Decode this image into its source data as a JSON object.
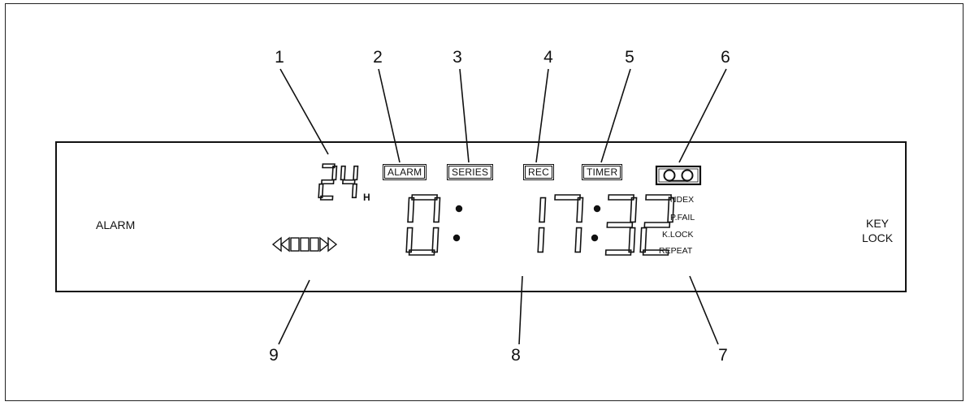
{
  "callouts": [
    "1",
    "2",
    "3",
    "4",
    "5",
    "6",
    "7",
    "8",
    "9"
  ],
  "hour_mode": {
    "digits": "24",
    "suffix": "H"
  },
  "indicators": {
    "alarm": "ALARM",
    "series": "SERIES",
    "rec": "REC",
    "timer": "TIMER"
  },
  "side_labels": {
    "left": "ALARM",
    "right_line1": "KEY",
    "right_line2": "LOCK"
  },
  "status_labels": [
    "INDEX",
    "P.FAIL",
    "K.LOCK",
    "REPEAT"
  ],
  "time_readout": "0:17:32",
  "icons": {
    "tape": "cassette-tape-icon",
    "transport": "transport-arrows-icon"
  }
}
